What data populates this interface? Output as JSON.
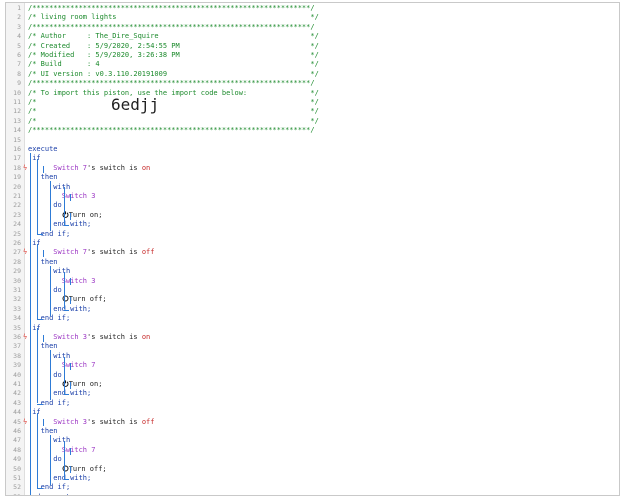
{
  "header": [
    "/******************************************************************/",
    "/* living room lights                                              */",
    "/******************************************************************/",
    "/* Author     : The_Dire_Squire                                    */",
    "/* Created    : 5/9/2020, 2:54:55 PM                               */",
    "/* Modified   : 5/9/2020, 3:26:38 PM                               */",
    "/* Build      : 4                                                  */",
    "/* UI version : v0.3.110.20191009                                  */",
    "/******************************************************************/",
    "/* To import this piston, use the import code below:               */",
    "/*                                                                 */",
    "/*                                                                 */",
    "/*                                                                 */",
    "/******************************************************************/"
  ],
  "import_code": "6edjj",
  "keywords": {
    "execute": "execute",
    "end_execute": "end execute;",
    "if": "if",
    "then": "then",
    "with": "with",
    "do": "do",
    "end_with": "end with;",
    "end_if": "end if;"
  },
  "blocks": [
    {
      "cond_device": "Switch 7",
      "cond_text": "'s switch is ",
      "cond_value": "on",
      "target": "Switch 3",
      "action": "Turn on;"
    },
    {
      "cond_device": "Switch 7",
      "cond_text": "'s switch is ",
      "cond_value": "off",
      "target": "Switch 3",
      "action": "Turn off;"
    },
    {
      "cond_device": "Switch 3",
      "cond_text": "'s switch is ",
      "cond_value": "on",
      "target": "Switch 7",
      "action": "Turn on;"
    },
    {
      "cond_device": "Switch 3",
      "cond_text": "'s switch is ",
      "cond_value": "off",
      "target": "Switch 7",
      "action": "Turn off;"
    }
  ],
  "line_count": 54,
  "colors": {
    "comment": "#1c8a2c",
    "keyword": "#1a3ea8",
    "device": "#9c37c4",
    "value": "#c62828",
    "flag": "#e0463f"
  }
}
